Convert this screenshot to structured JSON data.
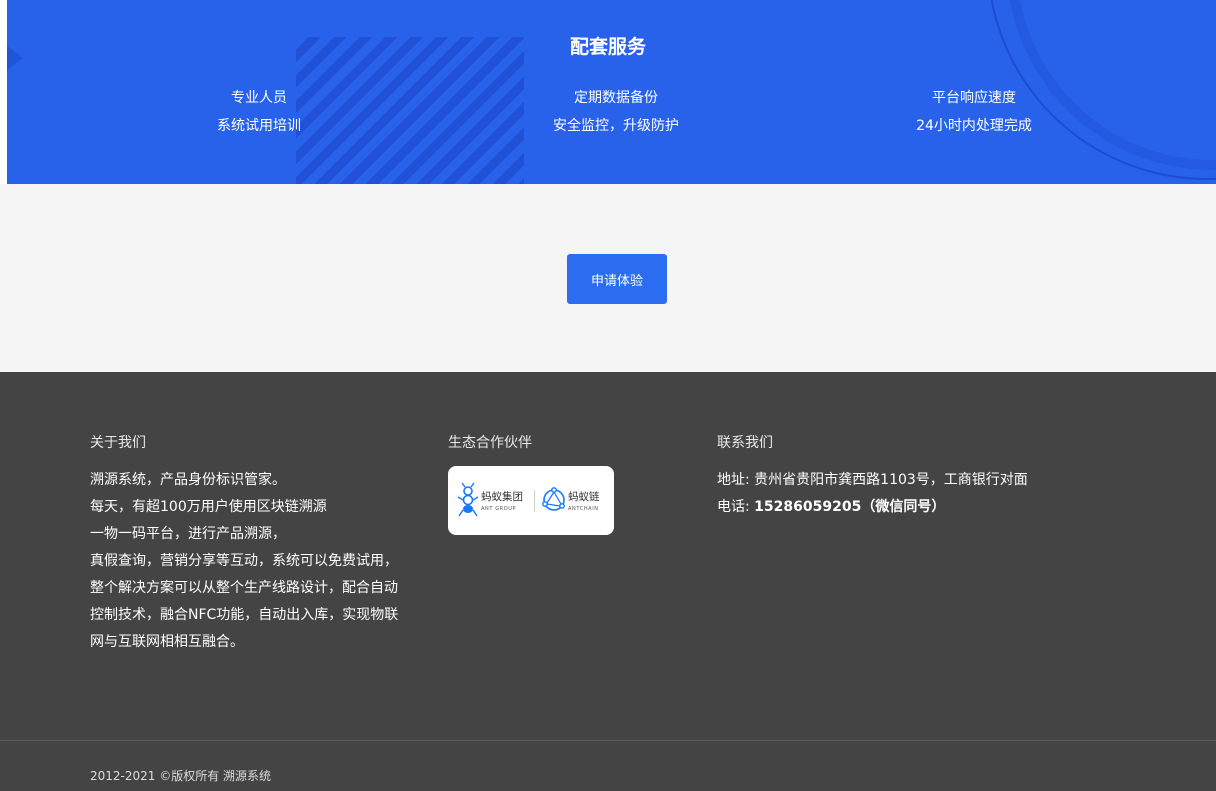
{
  "services": {
    "title": "配套服务",
    "columns": [
      {
        "line1": "专业人员",
        "line2": "系统试用培训"
      },
      {
        "line1": "定期数据备份",
        "line2": "安全监控，升级防护"
      },
      {
        "line1": "平台响应速度",
        "line2": "24小时内处理完成"
      }
    ]
  },
  "cta": {
    "label": "申请体验",
    "color": "#2b6df0"
  },
  "footer": {
    "about": {
      "title": "关于我们",
      "lines": [
        "溯源系统，产品身份标识管家。",
        "每天，有超100万用户使用区块链溯源",
        "一物一码平台，进行产品溯源，",
        "真假查询，营销分享等互动，系统可以免费试用，",
        "整个解决方案可以从整个生产线路设计，配合自动",
        "控制技术，融合NFC功能，自动出入库，实现物联",
        "网与互联网相相互融合。"
      ]
    },
    "partners": {
      "title": "生态合作伙伴",
      "ant_group": {
        "cn": "蚂蚁集团",
        "en": "ANT GROUP"
      },
      "ant_chain": {
        "cn": "蚂蚁链",
        "en": "ANTCHAIN"
      }
    },
    "contact": {
      "title": "联系我们",
      "address_label": "地址:",
      "address": "贵州省贵阳市龚西路1103号，工商银行对面",
      "phone_label": "电话:",
      "phone": "15286059205（微信同号）"
    },
    "copyright": "2012-2021 ©版权所有 溯源系统"
  },
  "colors": {
    "brand_blue": "#2962ea",
    "footer_bg": "#444444",
    "cta_bg": "#f5f5f5"
  }
}
